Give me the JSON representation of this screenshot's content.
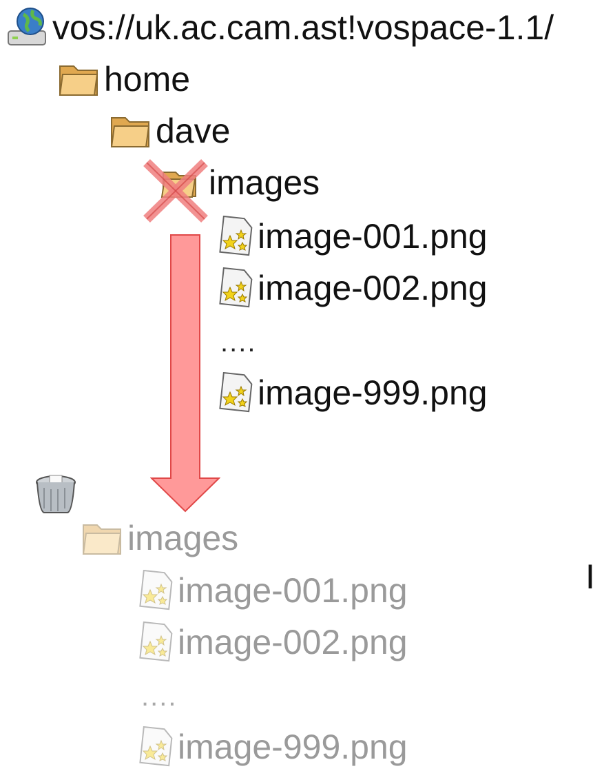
{
  "tree": {
    "root": {
      "label": "vos://uk.ac.cam.ast!vospace-1.1/",
      "icon": "network-drive-globe-icon"
    },
    "home": {
      "label": "home",
      "icon": "folder-icon"
    },
    "user": {
      "label": "dave",
      "icon": "folder-icon"
    },
    "deleted_folder": {
      "label": "images",
      "icon": "folder-icon",
      "status": "deleted"
    },
    "files": [
      {
        "label": "image-001.png",
        "icon": "image-file-icon"
      },
      {
        "label": "image-002.png",
        "icon": "image-file-icon"
      },
      {
        "label": "....",
        "icon": ""
      },
      {
        "label": "image-999.png",
        "icon": "image-file-icon"
      }
    ]
  },
  "trash": {
    "icon": "trash-can-icon",
    "folder": {
      "label": "images",
      "icon": "folder-icon"
    },
    "files": [
      {
        "label": "image-001.png",
        "icon": "image-file-icon"
      },
      {
        "label": "image-002.png",
        "icon": "image-file-icon"
      },
      {
        "label": "....",
        "icon": ""
      },
      {
        "label": "image-999.png",
        "icon": "image-file-icon"
      }
    ]
  },
  "edge_text": "I",
  "colors": {
    "text": "#111111",
    "dim_text": "#9a9a9a",
    "folder": "#f0c070",
    "cross": "#f08080",
    "arrow": "#ff9999",
    "arrow_stroke": "#e04848"
  }
}
